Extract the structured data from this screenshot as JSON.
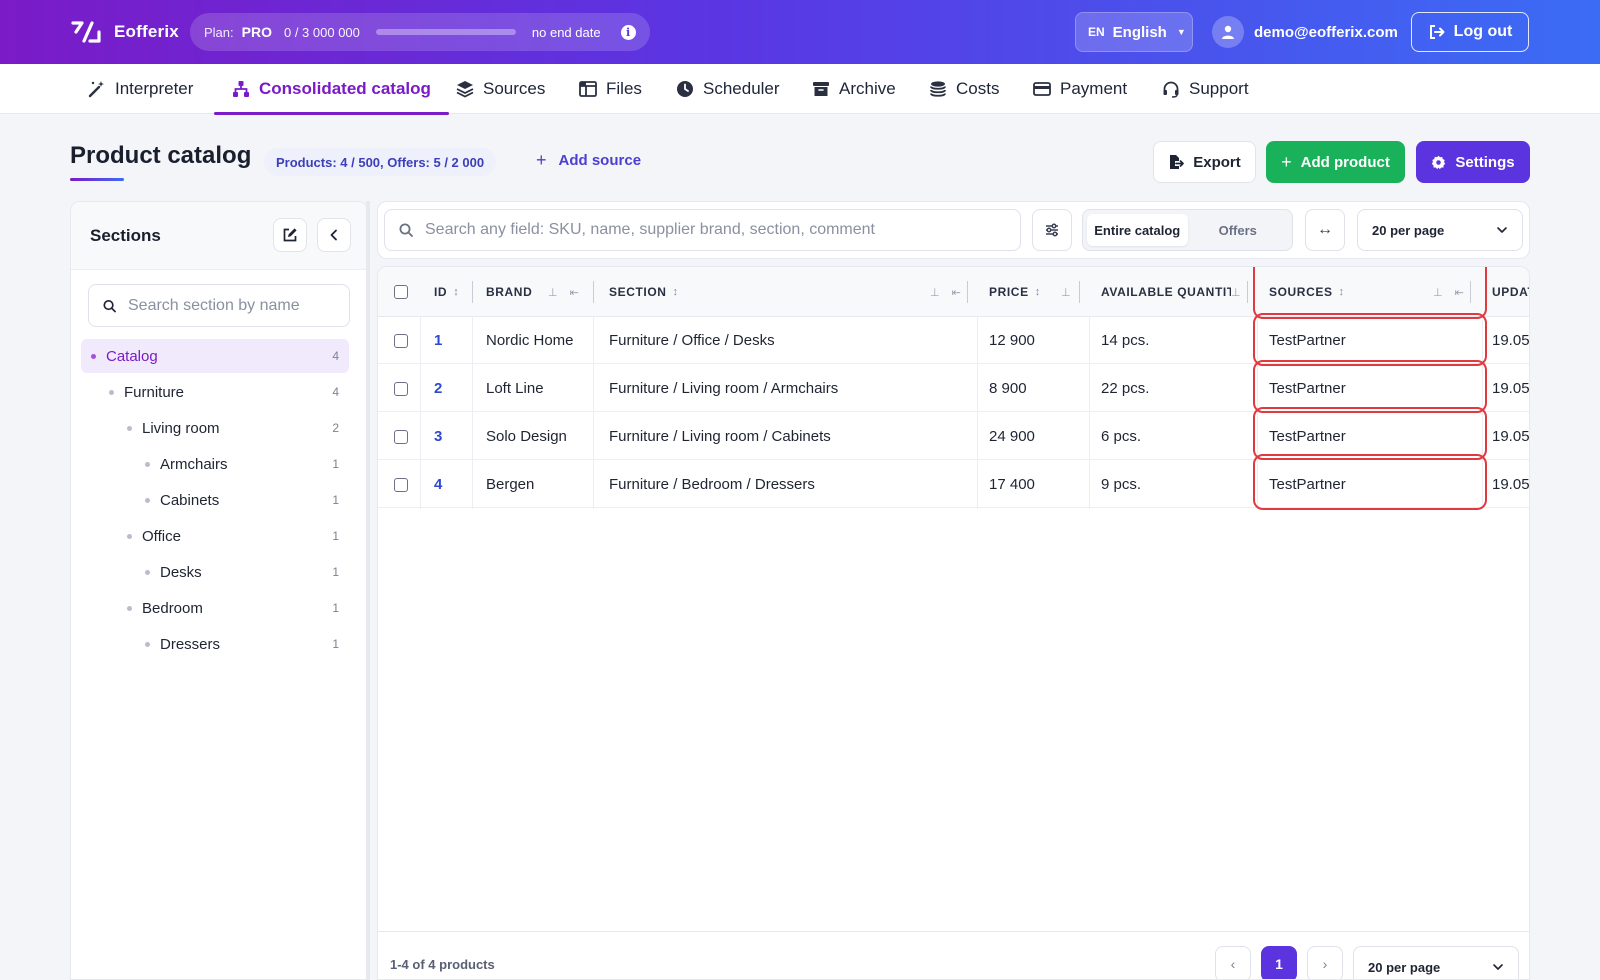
{
  "app": {
    "name": "Eofferix"
  },
  "plan": {
    "label": "Plan:",
    "name": "PRO",
    "usage": "0 / 3 000 000",
    "progress": 0,
    "expiry": "no end date",
    "info_icon": "info-icon"
  },
  "language": {
    "code": "EN",
    "label": "English"
  },
  "user": {
    "email": "demo@eofferix.com"
  },
  "logout_label": "Log out",
  "nav": [
    {
      "label": "Interpreter",
      "icon": "magic-wand-icon"
    },
    {
      "label": "Consolidated catalog",
      "icon": "sitemap-icon",
      "active": true
    },
    {
      "label": "Sources",
      "icon": "layers-icon"
    },
    {
      "label": "Files",
      "icon": "files-icon"
    },
    {
      "label": "Scheduler",
      "icon": "clock-icon"
    },
    {
      "label": "Archive",
      "icon": "archive-icon"
    },
    {
      "label": "Costs",
      "icon": "coins-icon"
    },
    {
      "label": "Payment",
      "icon": "credit-card-icon"
    },
    {
      "label": "Support",
      "icon": "headset-icon"
    }
  ],
  "page": {
    "title": "Product catalog",
    "counts": "Products: 4 / 500, Offers: 5 / 2 000",
    "add_source": "Add source",
    "export": "Export",
    "add_product": "Add product",
    "settings": "Settings"
  },
  "sidebar": {
    "title": "Sections",
    "search_placeholder": "Search section by name",
    "tree": [
      {
        "label": "Catalog",
        "count": "4",
        "level": 0,
        "selected": true
      },
      {
        "label": "Furniture",
        "count": "4",
        "level": 1
      },
      {
        "label": "Living room",
        "count": "2",
        "level": 2
      },
      {
        "label": "Armchairs",
        "count": "1",
        "level": 3
      },
      {
        "label": "Cabinets",
        "count": "1",
        "level": 3
      },
      {
        "label": "Office",
        "count": "1",
        "level": 2
      },
      {
        "label": "Desks",
        "count": "1",
        "level": 3
      },
      {
        "label": "Bedroom",
        "count": "1",
        "level": 2
      },
      {
        "label": "Dressers",
        "count": "1",
        "level": 3
      }
    ]
  },
  "toolbar": {
    "search_placeholder": "Search any field: SKU, name, supplier brand, section, comment",
    "scope": [
      "Entire catalog",
      "Offers"
    ],
    "scope_selected": "Entire catalog",
    "per_page": "20 per page"
  },
  "table": {
    "columns": [
      "ID",
      "BRAND",
      "SECTION",
      "PRICE",
      "AVAILABLE QUANTITY",
      "SOURCES",
      "UPDATED"
    ],
    "rows": [
      {
        "id": "1",
        "brand": "Nordic Home",
        "section": "Furniture / Office / Desks",
        "price": "12 900",
        "qty": "14 pcs.",
        "sources": "TestPartner",
        "updated": "19.05"
      },
      {
        "id": "2",
        "brand": "Loft Line",
        "section": "Furniture / Living room / Armchairs",
        "price": "8 900",
        "qty": "22 pcs.",
        "sources": "TestPartner",
        "updated": "19.05"
      },
      {
        "id": "3",
        "brand": "Solo Design",
        "section": "Furniture / Living room / Cabinets",
        "price": "24 900",
        "qty": "6 pcs.",
        "sources": "TestPartner",
        "updated": "19.05"
      },
      {
        "id": "4",
        "brand": "Bergen",
        "section": "Furniture / Bedroom / Dressers",
        "price": "17 400",
        "qty": "9 pcs.",
        "sources": "TestPartner",
        "updated": "19.05"
      }
    ]
  },
  "footer": {
    "count": "1-4 of 4 products",
    "prev": "‹",
    "page": "1",
    "next": "›",
    "per_page": "20 per page"
  },
  "colors": {
    "brand_purple": "#7a1bc7",
    "accent_blue": "#3b6cf5",
    "add_green": "#19b15a",
    "settings_violet": "#5b34e0",
    "highlight_red": "#e0393e"
  }
}
